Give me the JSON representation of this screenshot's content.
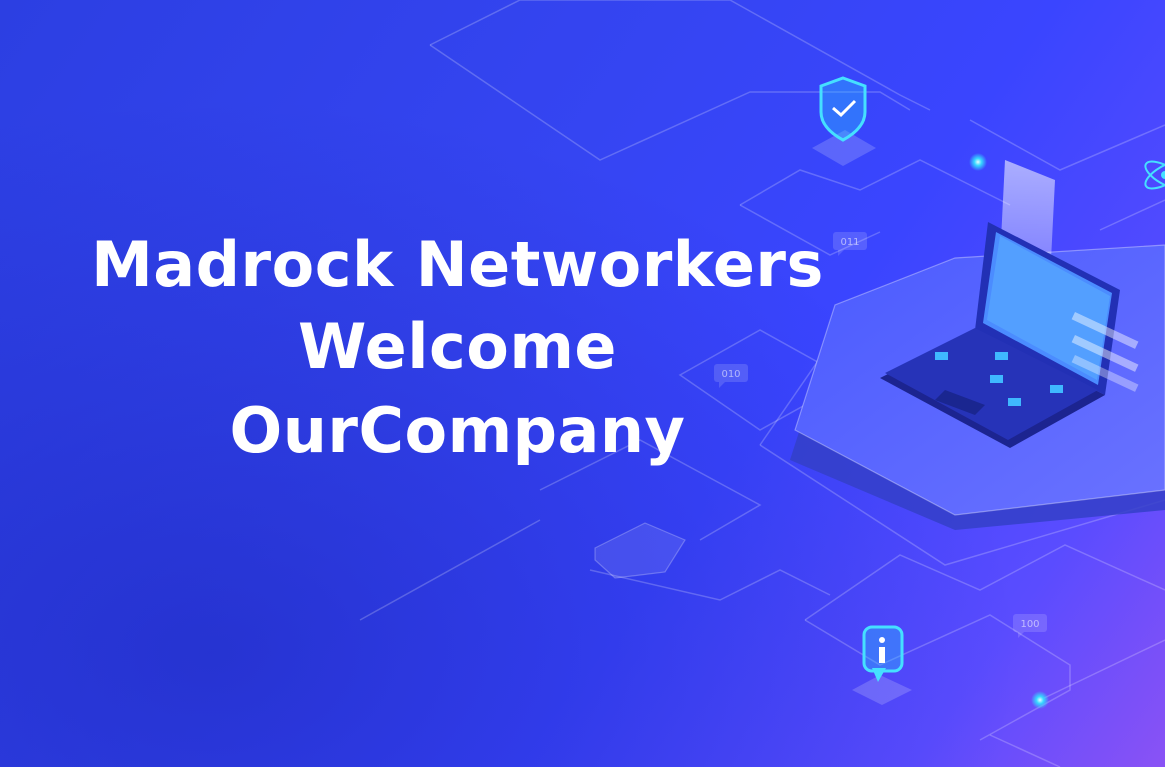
{
  "banner": {
    "headline": {
      "line1": "Madrock Networkers",
      "line2": "Welcome",
      "line3": "OurCompany"
    },
    "binary_tags": [
      "011",
      "010",
      "100"
    ],
    "icons": [
      "shield-check-icon",
      "info-icon",
      "laptop-icon",
      "atom-icon"
    ],
    "colors": {
      "background_start": "#2c3fe2",
      "background_mid": "#3a45ff",
      "background_end": "#8a52f5",
      "text": "#ffffff",
      "glow": "#35d8ff"
    }
  }
}
